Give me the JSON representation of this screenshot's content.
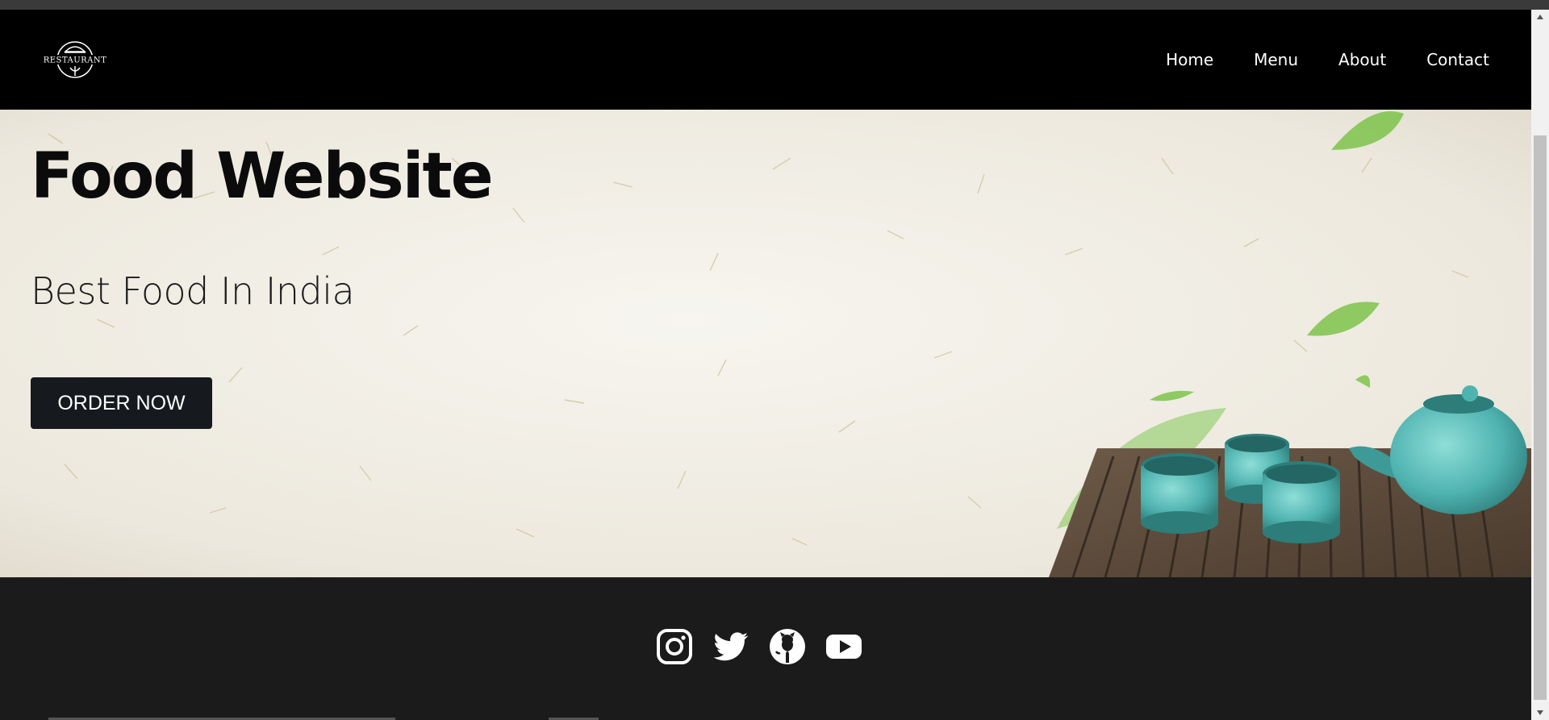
{
  "nav": {
    "logo_text": "RESTAURANT",
    "links": [
      "Home",
      "Menu",
      "About",
      "Contact"
    ]
  },
  "hero": {
    "title": "Food Website",
    "subtitle": "Best Food In India",
    "cta_label": "ORDER NOW"
  },
  "footer": {
    "social": [
      "instagram-icon",
      "twitter-icon",
      "github-icon",
      "youtube-icon"
    ]
  },
  "colors": {
    "nav_bg": "#000000",
    "footer_bg": "#1b1b1b",
    "button_bg": "#161a1e",
    "tea_set": "#4fb3b0",
    "leaf": "#7cc34a"
  }
}
